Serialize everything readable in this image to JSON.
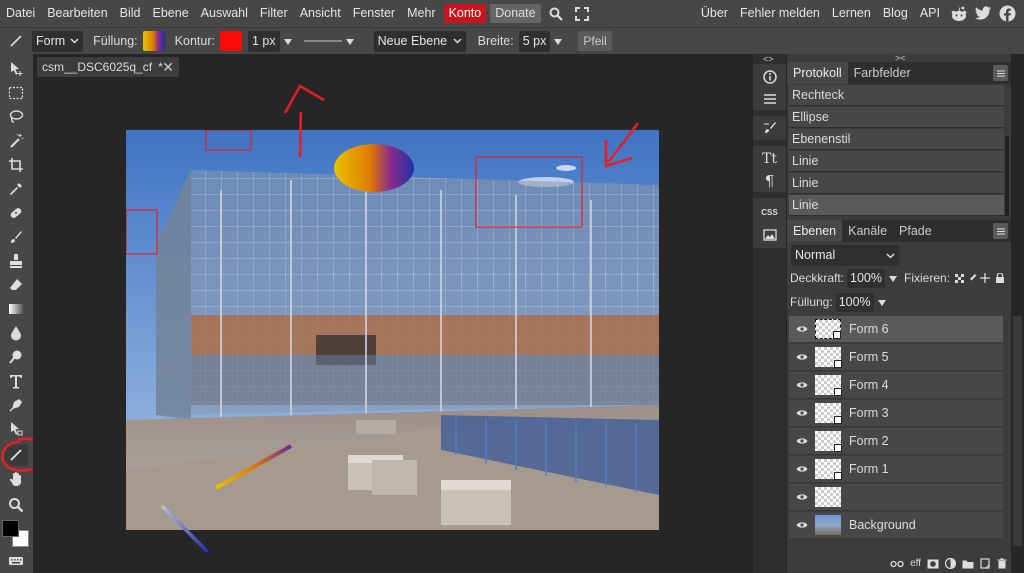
{
  "menu": {
    "items": [
      "Datei",
      "Bearbeiten",
      "Bild",
      "Ebene",
      "Auswahl",
      "Filter",
      "Ansicht",
      "Fenster",
      "Mehr"
    ],
    "konto": "Konto",
    "donate": "Donate",
    "right_items": [
      "Über",
      "Fehler melden",
      "Lernen",
      "Blog",
      "API"
    ],
    "icons": [
      "search-icon",
      "fullscreen-icon",
      "reddit-icon",
      "twitter-icon",
      "facebook-icon"
    ]
  },
  "options": {
    "shape_mode": "Form",
    "fill_label": "Füllung:",
    "stroke_label": "Kontur:",
    "stroke_width": "1 px",
    "layer_mode": "Neue Ebene",
    "width_label": "Breite:",
    "width_value": "5 px",
    "arrow_label": "Pfeil",
    "stroke_color": "#ff0a0a"
  },
  "document": {
    "tab_title": "csm__DSC6025q_cf",
    "tab_modified": "*",
    "close_symbol": "✕"
  },
  "history": {
    "tabs": [
      "Protokoll",
      "Farbfelder"
    ],
    "items": [
      "Rechteck",
      "Ellipse",
      "Ebenenstil",
      "Linie",
      "Linie",
      "Linie"
    ]
  },
  "layers": {
    "tabs": [
      "Ebenen",
      "Kanäle",
      "Pfade"
    ],
    "blend_mode": "Normal",
    "opacity_label": "Deckkraft:",
    "opacity_value": "100%",
    "lock_label": "Fixieren:",
    "fill_label": "Füllung:",
    "fill_value": "100%",
    "items": [
      {
        "name": "Form 6",
        "selected": true
      },
      {
        "name": "Form 5",
        "selected": false
      },
      {
        "name": "Form 4",
        "selected": false
      },
      {
        "name": "Form 3",
        "selected": false
      },
      {
        "name": "Form 2",
        "selected": false
      },
      {
        "name": "Form 1",
        "selected": false
      },
      {
        "name": "",
        "selected": false
      },
      {
        "name": "Background",
        "selected": false
      }
    ],
    "footer_label": "eff"
  },
  "colors": {
    "accent_red": "#c8141e",
    "annotation_red": "#e0202a",
    "panel_bg": "#3c3c3c",
    "bar_bg": "#474747"
  }
}
